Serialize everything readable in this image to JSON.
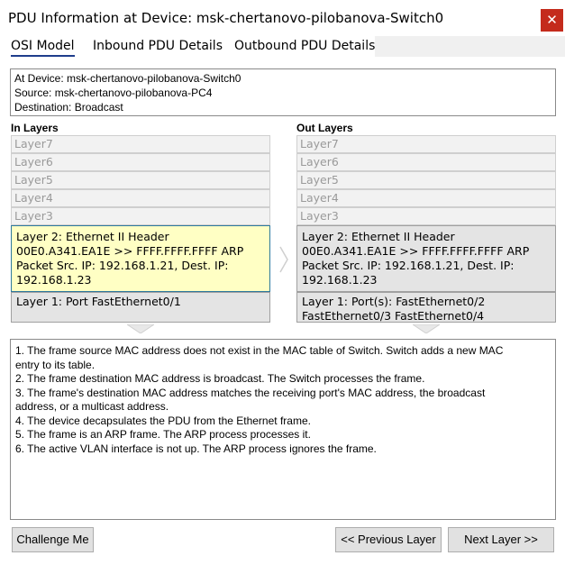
{
  "window": {
    "title": "PDU Information at Device: msk-chertanovo-pilobanova-Switch0",
    "close_label": "✕"
  },
  "tabs": [
    {
      "label": "OSI Model",
      "active": true
    },
    {
      "label": "Inbound PDU Details",
      "active": false
    },
    {
      "label": "Outbound PDU Details",
      "active": false
    }
  ],
  "info": {
    "device": "At Device: msk-chertanovo-pilobanova-Switch0",
    "source": "Source: msk-chertanovo-pilobanova-PC4",
    "destination": "Destination: Broadcast"
  },
  "in_layers": {
    "heading": "In Layers",
    "inactive": [
      "Layer7",
      "Layer6",
      "Layer5",
      "Layer4",
      "Layer3"
    ],
    "layer2": [
      "Layer 2: Ethernet II Header",
      "00E0.A341.EA1E >> FFFF.FFFF.FFFF ARP",
      "Packet Src. IP: 192.168.1.21, Dest. IP:",
      "192.168.1.23"
    ],
    "layer1": [
      "Layer 1: Port FastEthernet0/1"
    ]
  },
  "out_layers": {
    "heading": "Out Layers",
    "inactive": [
      "Layer7",
      "Layer6",
      "Layer5",
      "Layer4",
      "Layer3"
    ],
    "layer2": [
      "Layer 2: Ethernet II Header",
      "00E0.A341.EA1E >> FFFF.FFFF.FFFF ARP",
      "Packet Src. IP: 192.168.1.21, Dest. IP:",
      "192.168.1.23"
    ],
    "layer1": [
      "Layer 1: Port(s): FastEthernet0/2",
      "FastEthernet0/3 FastEthernet0/4"
    ]
  },
  "description": [
    "1. The frame source MAC address does not exist in the MAC table of Switch. Switch adds a new MAC",
    "entry to its table.",
    "2. The frame destination MAC address is broadcast. The Switch processes the frame.",
    "3. The frame's destination MAC address matches the receiving port's MAC address, the broadcast",
    "address, or a multicast address.",
    "4. The device decapsulates the PDU from the Ethernet frame.",
    "5. The frame is an ARP frame. The ARP process processes it.",
    "6. The active VLAN interface is not up. The ARP process ignores the frame."
  ],
  "buttons": {
    "challenge": "Challenge Me",
    "previous": "<< Previous Layer",
    "next": "Next Layer >>"
  },
  "colors": {
    "selected_layer": "#ffffc4",
    "close_button": "#c42b1c",
    "active_tab_underline": "#1f3d8c"
  }
}
